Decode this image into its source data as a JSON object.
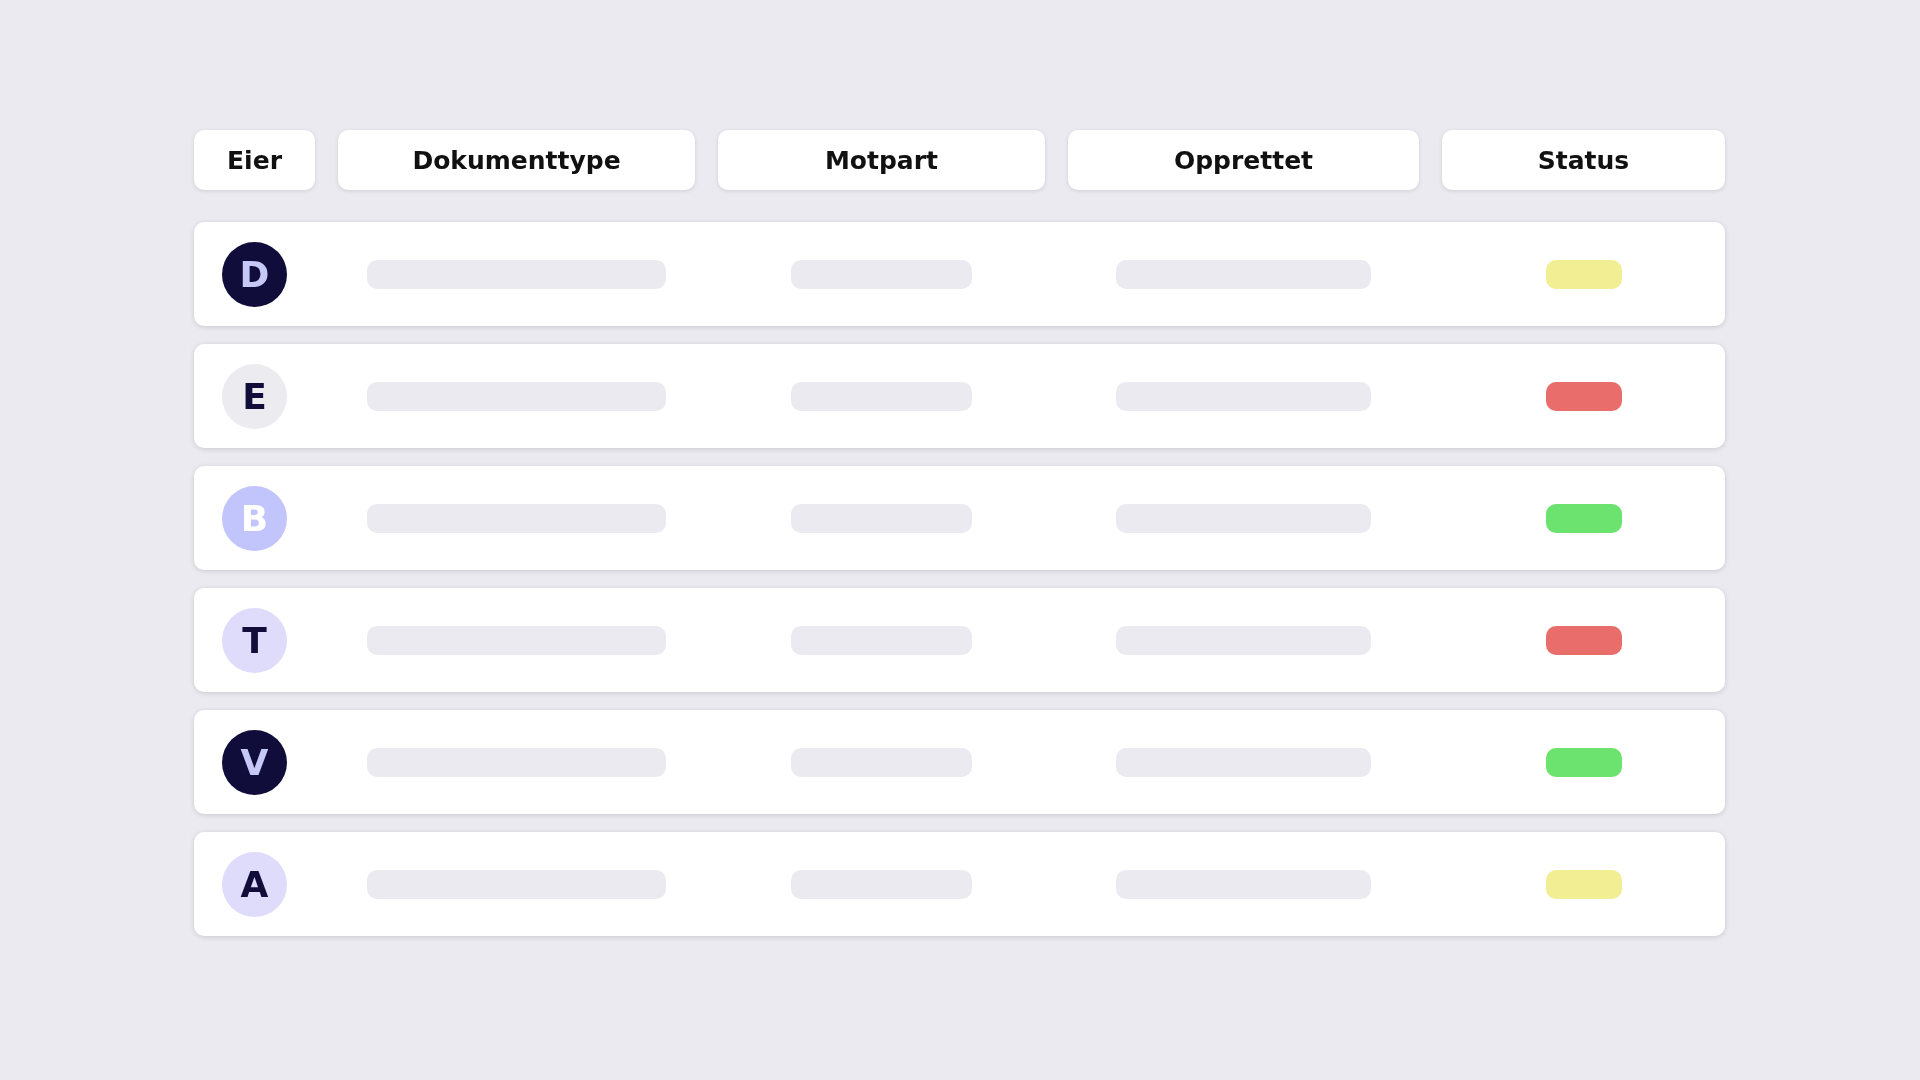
{
  "table": {
    "columns": [
      "Eier",
      "Dokumenttype",
      "Motpart",
      "Opprettet",
      "Status"
    ],
    "rows": [
      {
        "avatar": {
          "letter": "D",
          "color": "#100d3b"
        },
        "status": {
          "color": "#f2ee94"
        }
      },
      {
        "avatar": {
          "letter": "E",
          "color": "#ebebf0"
        },
        "status": {
          "color": "#e86d6b"
        }
      },
      {
        "avatar": {
          "letter": "B",
          "color": "#c2c5fb"
        },
        "status": {
          "color": "#6de36f"
        }
      },
      {
        "avatar": {
          "letter": "T",
          "color": "#dedcfa"
        },
        "status": {
          "color": "#e86d6b"
        }
      },
      {
        "avatar": {
          "letter": "V",
          "color": "#100d3b"
        },
        "status": {
          "color": "#6de36f"
        }
      },
      {
        "avatar": {
          "letter": "A",
          "color": "#dedcfa"
        },
        "status": {
          "color": "#f2ee94"
        }
      }
    ]
  }
}
